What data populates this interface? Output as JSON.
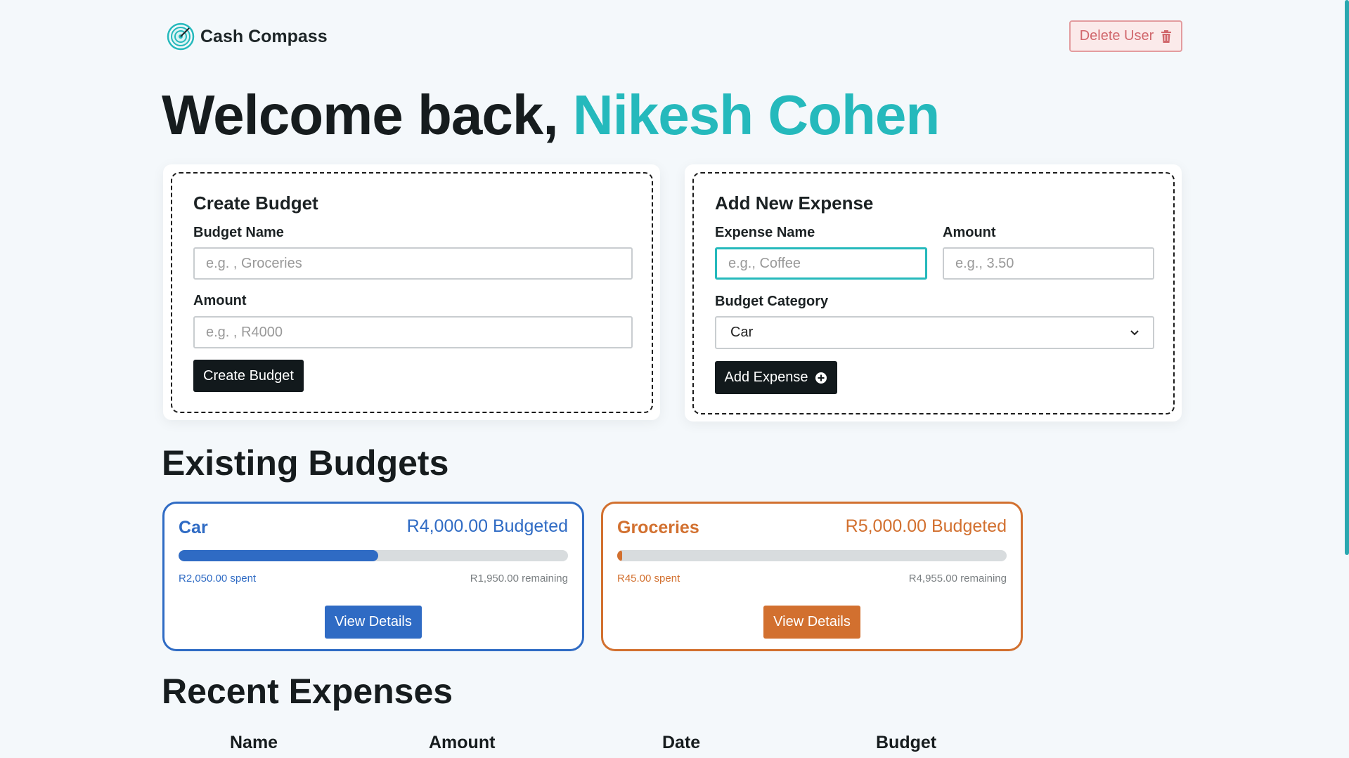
{
  "app": {
    "name": "Cash Compass",
    "logo_icon": "target-icon"
  },
  "header": {
    "delete_user_label": "Delete User",
    "delete_icon": "trash-icon"
  },
  "welcome": {
    "prefix": "Welcome back,",
    "user_name": "Nikesh Cohen"
  },
  "create_budget": {
    "title": "Create Budget",
    "name_label": "Budget Name",
    "name_placeholder": "e.g. , Groceries",
    "amount_label": "Amount",
    "amount_placeholder": "e.g. , R4000",
    "button_label": "Create Budget"
  },
  "add_expense": {
    "title": "Add New Expense",
    "name_label": "Expense Name",
    "name_placeholder": "e.g., Coffee",
    "amount_label": "Amount",
    "amount_placeholder": "e.g., 3.50",
    "category_label": "Budget Category",
    "category_selected": "Car",
    "button_label": "Add Expense",
    "button_icon": "plus-circle-icon"
  },
  "existing_budgets": {
    "title": "Existing Budgets",
    "items": [
      {
        "name": "Car",
        "budgeted": "R4,000.00 Budgeted",
        "spent": "R2,050.00 spent",
        "remaining": "R1,950.00 remaining",
        "progress": 0.5125,
        "color": "#2f6bc4",
        "button_label": "View Details"
      },
      {
        "name": "Groceries",
        "budgeted": "R5,000.00 Budgeted",
        "spent": "R45.00 spent",
        "remaining": "R4,955.00 remaining",
        "progress": 0.009,
        "color": "#d2702f",
        "button_label": "View Details"
      }
    ]
  },
  "recent_expenses": {
    "title": "Recent Expenses",
    "columns": [
      "Name",
      "Amount",
      "Date",
      "Budget"
    ]
  }
}
